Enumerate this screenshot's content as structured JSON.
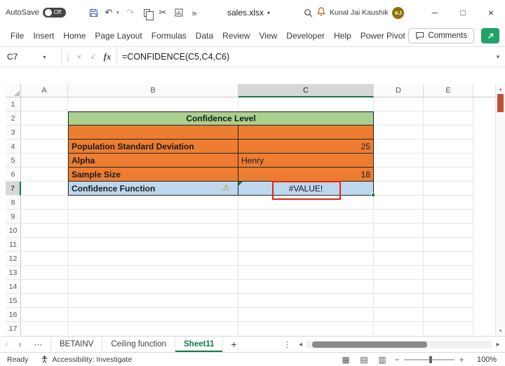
{
  "titlebar": {
    "autosave_label": "AutoSave",
    "autosave_state": "Off",
    "filename": "sales.xlsx",
    "user_name": "Kunal Jai Kaushik",
    "user_initials": "KJ"
  },
  "ribbon": {
    "tabs": [
      "File",
      "Insert",
      "Home",
      "Page Layout",
      "Formulas",
      "Data",
      "Review",
      "View",
      "Developer",
      "Help",
      "Power Pivot"
    ],
    "comments_label": "Comments"
  },
  "formula_bar": {
    "name_box": "C7",
    "fx_label": "fx",
    "formula": "=CONFIDENCE(C5,C4,C6)"
  },
  "grid": {
    "columns": [
      "A",
      "B",
      "C",
      "D",
      "E"
    ],
    "row_numbers": [
      "1",
      "2",
      "3",
      "4",
      "5",
      "6",
      "7",
      "8",
      "9",
      "10",
      "11",
      "12",
      "13",
      "14",
      "15",
      "16",
      "17"
    ],
    "active_cell": "C7",
    "table": {
      "title": "Confidence Level",
      "rows": [
        {
          "label": "Population Standard Deviation",
          "value": "25"
        },
        {
          "label": "Alpha",
          "value": "Henry"
        },
        {
          "label": "Sample Size",
          "value": "18"
        },
        {
          "label": "Confidence Function",
          "value": "#VALUE!"
        }
      ]
    }
  },
  "sheet_tabs": {
    "tabs": [
      "BETAINV",
      "Ceiling function",
      "Sheet11"
    ],
    "active_tab": "Sheet11"
  },
  "status_bar": {
    "mode": "Ready",
    "accessibility": "Accessibility: Investigate",
    "zoom": "100%"
  },
  "colors": {
    "title_green": "#A9D08E",
    "row_orange": "#ED7D31",
    "row_blue": "#BDD7EE",
    "excel_green": "#107C41",
    "error_red": "#E5231B"
  },
  "icons": {
    "undo": "↶",
    "redo": "↷",
    "cut": "✂",
    "more_chevrons": "»",
    "caret_down": "▾",
    "warning": "⚠",
    "minimize": "─",
    "maximize": "□",
    "close": "×",
    "nav_left": "‹",
    "nav_right": "›",
    "more_dots": "⋯",
    "kebab": "⋮",
    "add_sheet": "+",
    "scroll_left": "◂",
    "scroll_right": "▸",
    "scroll_up": "▴",
    "scroll_down": "▾",
    "view_normal": "▦",
    "view_layout": "▤",
    "view_break": "▥",
    "zoom_out": "−",
    "zoom_in": "+"
  }
}
